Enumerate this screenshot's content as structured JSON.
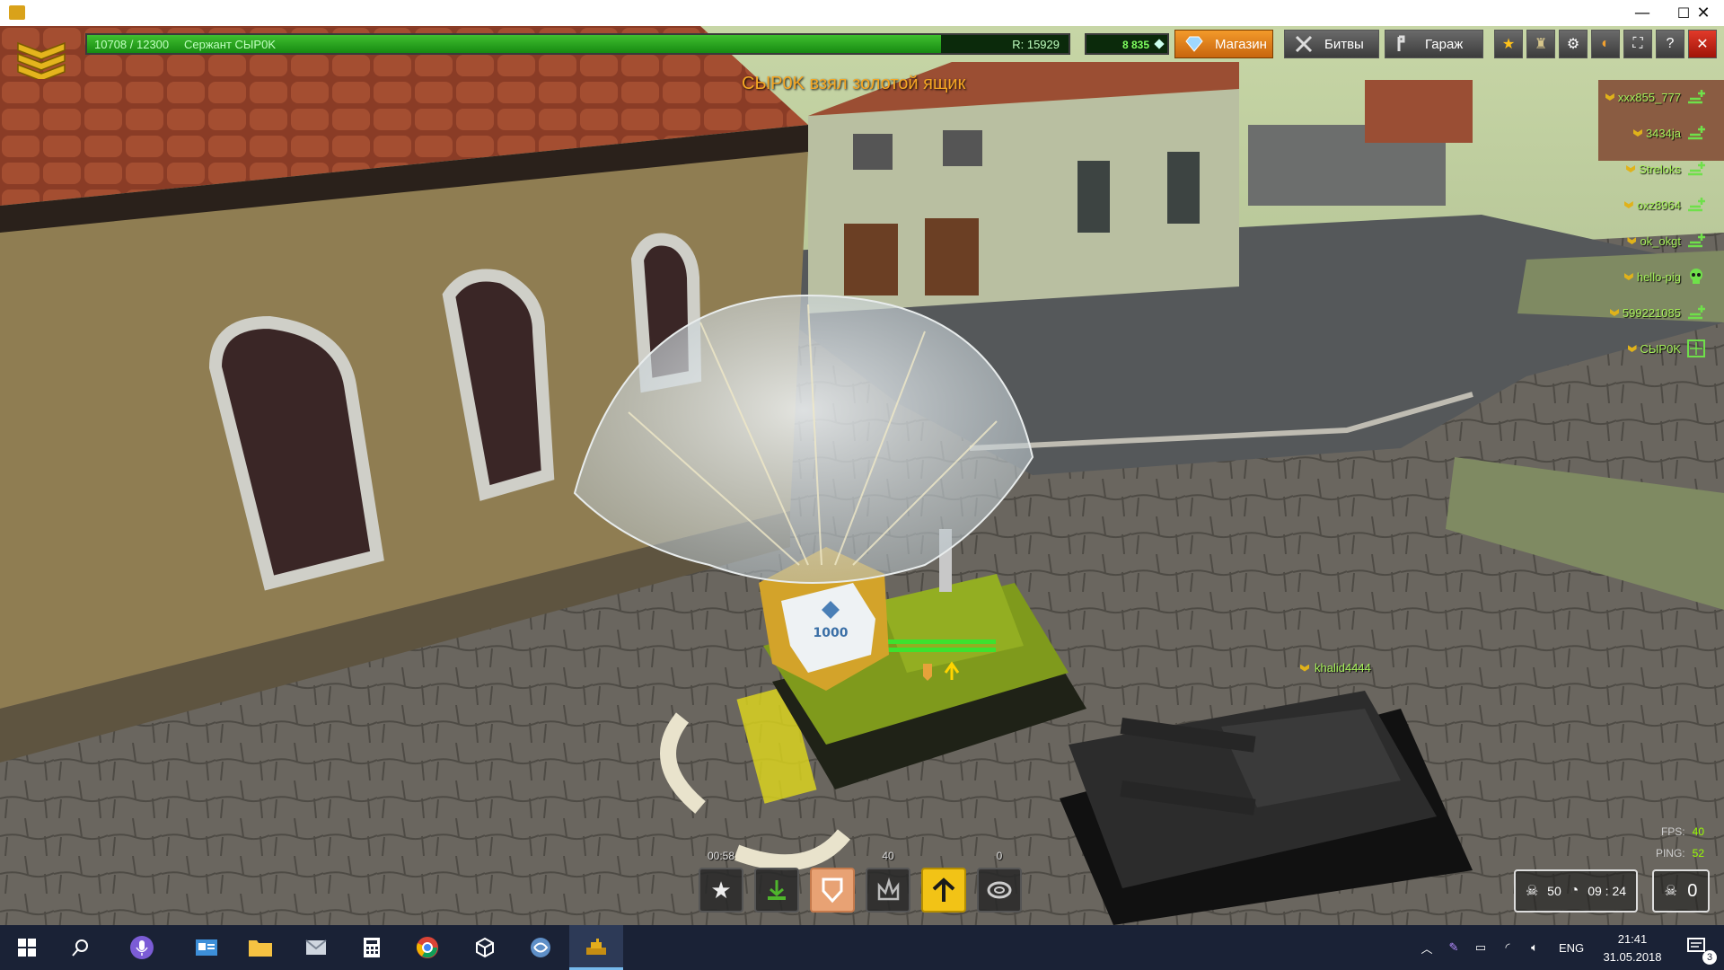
{
  "window": {
    "minimize": "—",
    "maximize": "☐",
    "close": "✕"
  },
  "hud": {
    "xp_text": "10708 / 12300",
    "rank_name": "Сержант CЫP0K",
    "rating": "R: 15929",
    "xp_progress": 0.87,
    "crystals": "8 835",
    "shop_label": "Магазин",
    "battles_label": "Битвы",
    "garage_label": "Гараж"
  },
  "notification": "CЫP0K взял золотой ящик",
  "players": [
    {
      "name": "xxx855_777",
      "status": "plus"
    },
    {
      "name": "3434ja",
      "status": "plus"
    },
    {
      "name": "Streloks",
      "status": "plus"
    },
    {
      "name": "oxz8964",
      "status": "plus"
    },
    {
      "name": "ok_okgt",
      "status": "plus"
    },
    {
      "name": "hello-pig",
      "status": "skull"
    },
    {
      "name": "599221085",
      "status": "plus"
    },
    {
      "name": "CЫP0K",
      "status": "target"
    }
  ],
  "enemy_nick": "khalid4444",
  "crate_value": "1000",
  "supplies": [
    {
      "name": "gold-star",
      "count": "00:58"
    },
    {
      "name": "mine",
      "count": ""
    },
    {
      "name": "armor",
      "count": ""
    },
    {
      "name": "damage",
      "count": "40"
    },
    {
      "name": "speed",
      "count": ""
    },
    {
      "name": "repair",
      "count": "0"
    }
  ],
  "stats": {
    "fps_label": "FPS:",
    "fps_value": "40",
    "ping_label": "PING:",
    "ping_value": "52"
  },
  "score": {
    "kills": "50",
    "time": "09 : 24",
    "deaths": "0"
  },
  "taskbar": {
    "lang": "ENG",
    "time": "21:41",
    "date": "31.05.2018",
    "notifications": "3"
  },
  "colors": {
    "xp_fill": "#2fa822",
    "shop": "#e8841c",
    "nick": "#a6f05a",
    "notice": "#f5a623"
  }
}
